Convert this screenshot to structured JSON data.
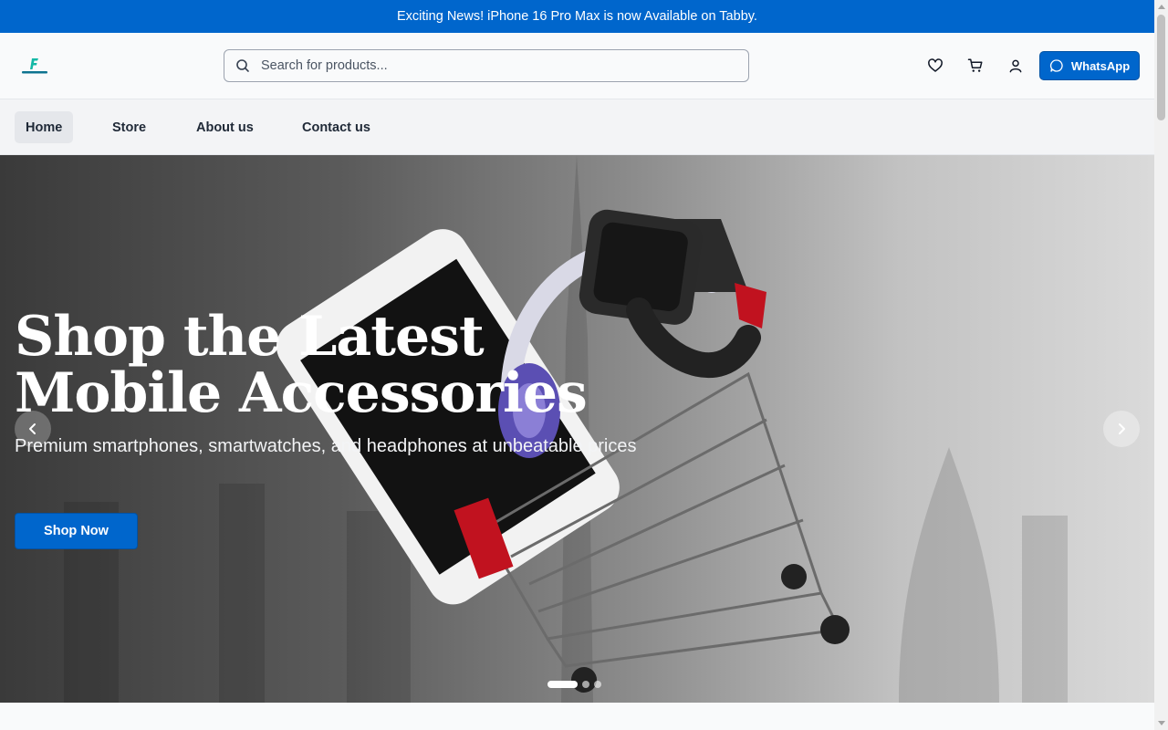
{
  "announcement": "Exciting News! iPhone 16 Pro Max is now Available on Tabby.",
  "header": {
    "logo_icon": "fleextech-logo",
    "search": {
      "placeholder": "Search for products...",
      "value": ""
    },
    "icons": [
      "heart-icon",
      "cart-icon",
      "user-icon"
    ],
    "whatsapp_label": "WhatsApp"
  },
  "nav": {
    "items": [
      {
        "label": "Home",
        "active": true
      },
      {
        "label": "Store",
        "active": false
      },
      {
        "label": "About us",
        "active": false
      },
      {
        "label": "Contact us",
        "active": false
      }
    ]
  },
  "hero": {
    "title": "Shop the Latest Mobile Accessories",
    "subtitle": "Premium smartphones, smartwatches, and headphones at unbeatable prices",
    "cta_label": "Shop Now",
    "slides_total": 3,
    "active_slide": 1
  },
  "colors": {
    "brand": "#0066cc",
    "announcement_bg": "#0066cc",
    "nav_bg": "#f3f4f6",
    "active_nav_bg": "#e5e7eb"
  }
}
